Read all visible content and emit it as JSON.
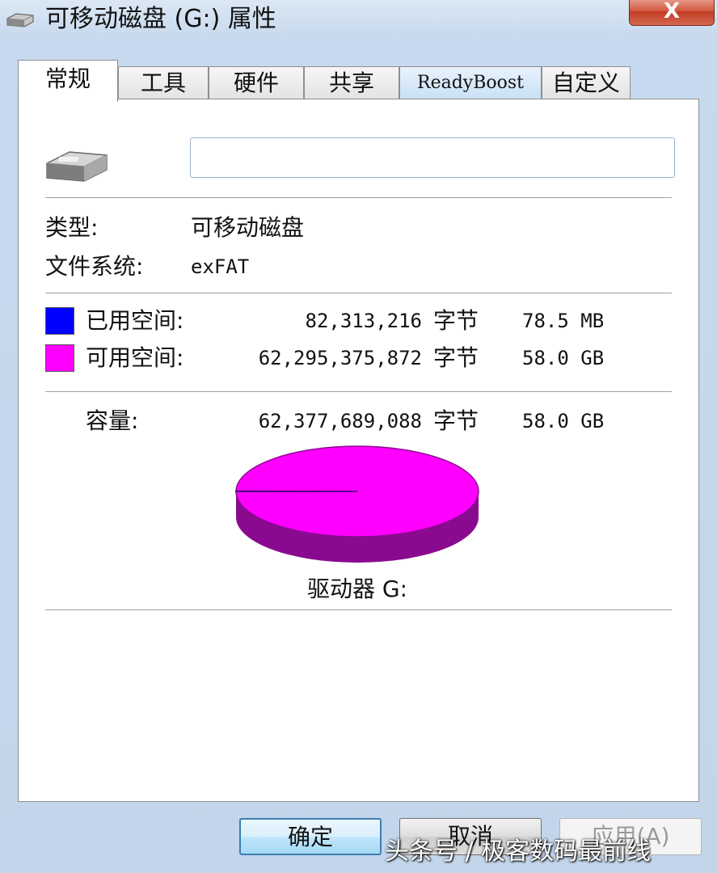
{
  "window": {
    "title": "可移动磁盘 (G:) 属性",
    "close_label": "X"
  },
  "tabs": [
    {
      "label": "常规",
      "active": true
    },
    {
      "label": "工具"
    },
    {
      "label": "硬件"
    },
    {
      "label": "共享"
    },
    {
      "label": "ReadyBoost"
    },
    {
      "label": "自定义"
    }
  ],
  "general": {
    "volume_name_value": "",
    "type_label": "类型:",
    "type_value": "可移动磁盘",
    "filesystem_label": "文件系统:",
    "filesystem_value": "exFAT",
    "used": {
      "label": "已用空间:",
      "bytes": "82,313,216",
      "unit": "字节",
      "size": "78.5 MB",
      "color": "#0000ff"
    },
    "free": {
      "label": "可用空间:",
      "bytes": "62,295,375,872",
      "unit": "字节",
      "size": "58.0 GB",
      "color": "#ff00ff"
    },
    "capacity": {
      "label": "容量:",
      "bytes": "62,377,689,088",
      "unit": "字节",
      "size": "58.0 GB"
    },
    "drive_label": "驱动器 G:",
    "used_fraction": 0.00132
  },
  "buttons": {
    "ok": "确定",
    "cancel": "取消",
    "apply": "应用(A)"
  },
  "watermark": "头条号 / 极客数码最前线"
}
